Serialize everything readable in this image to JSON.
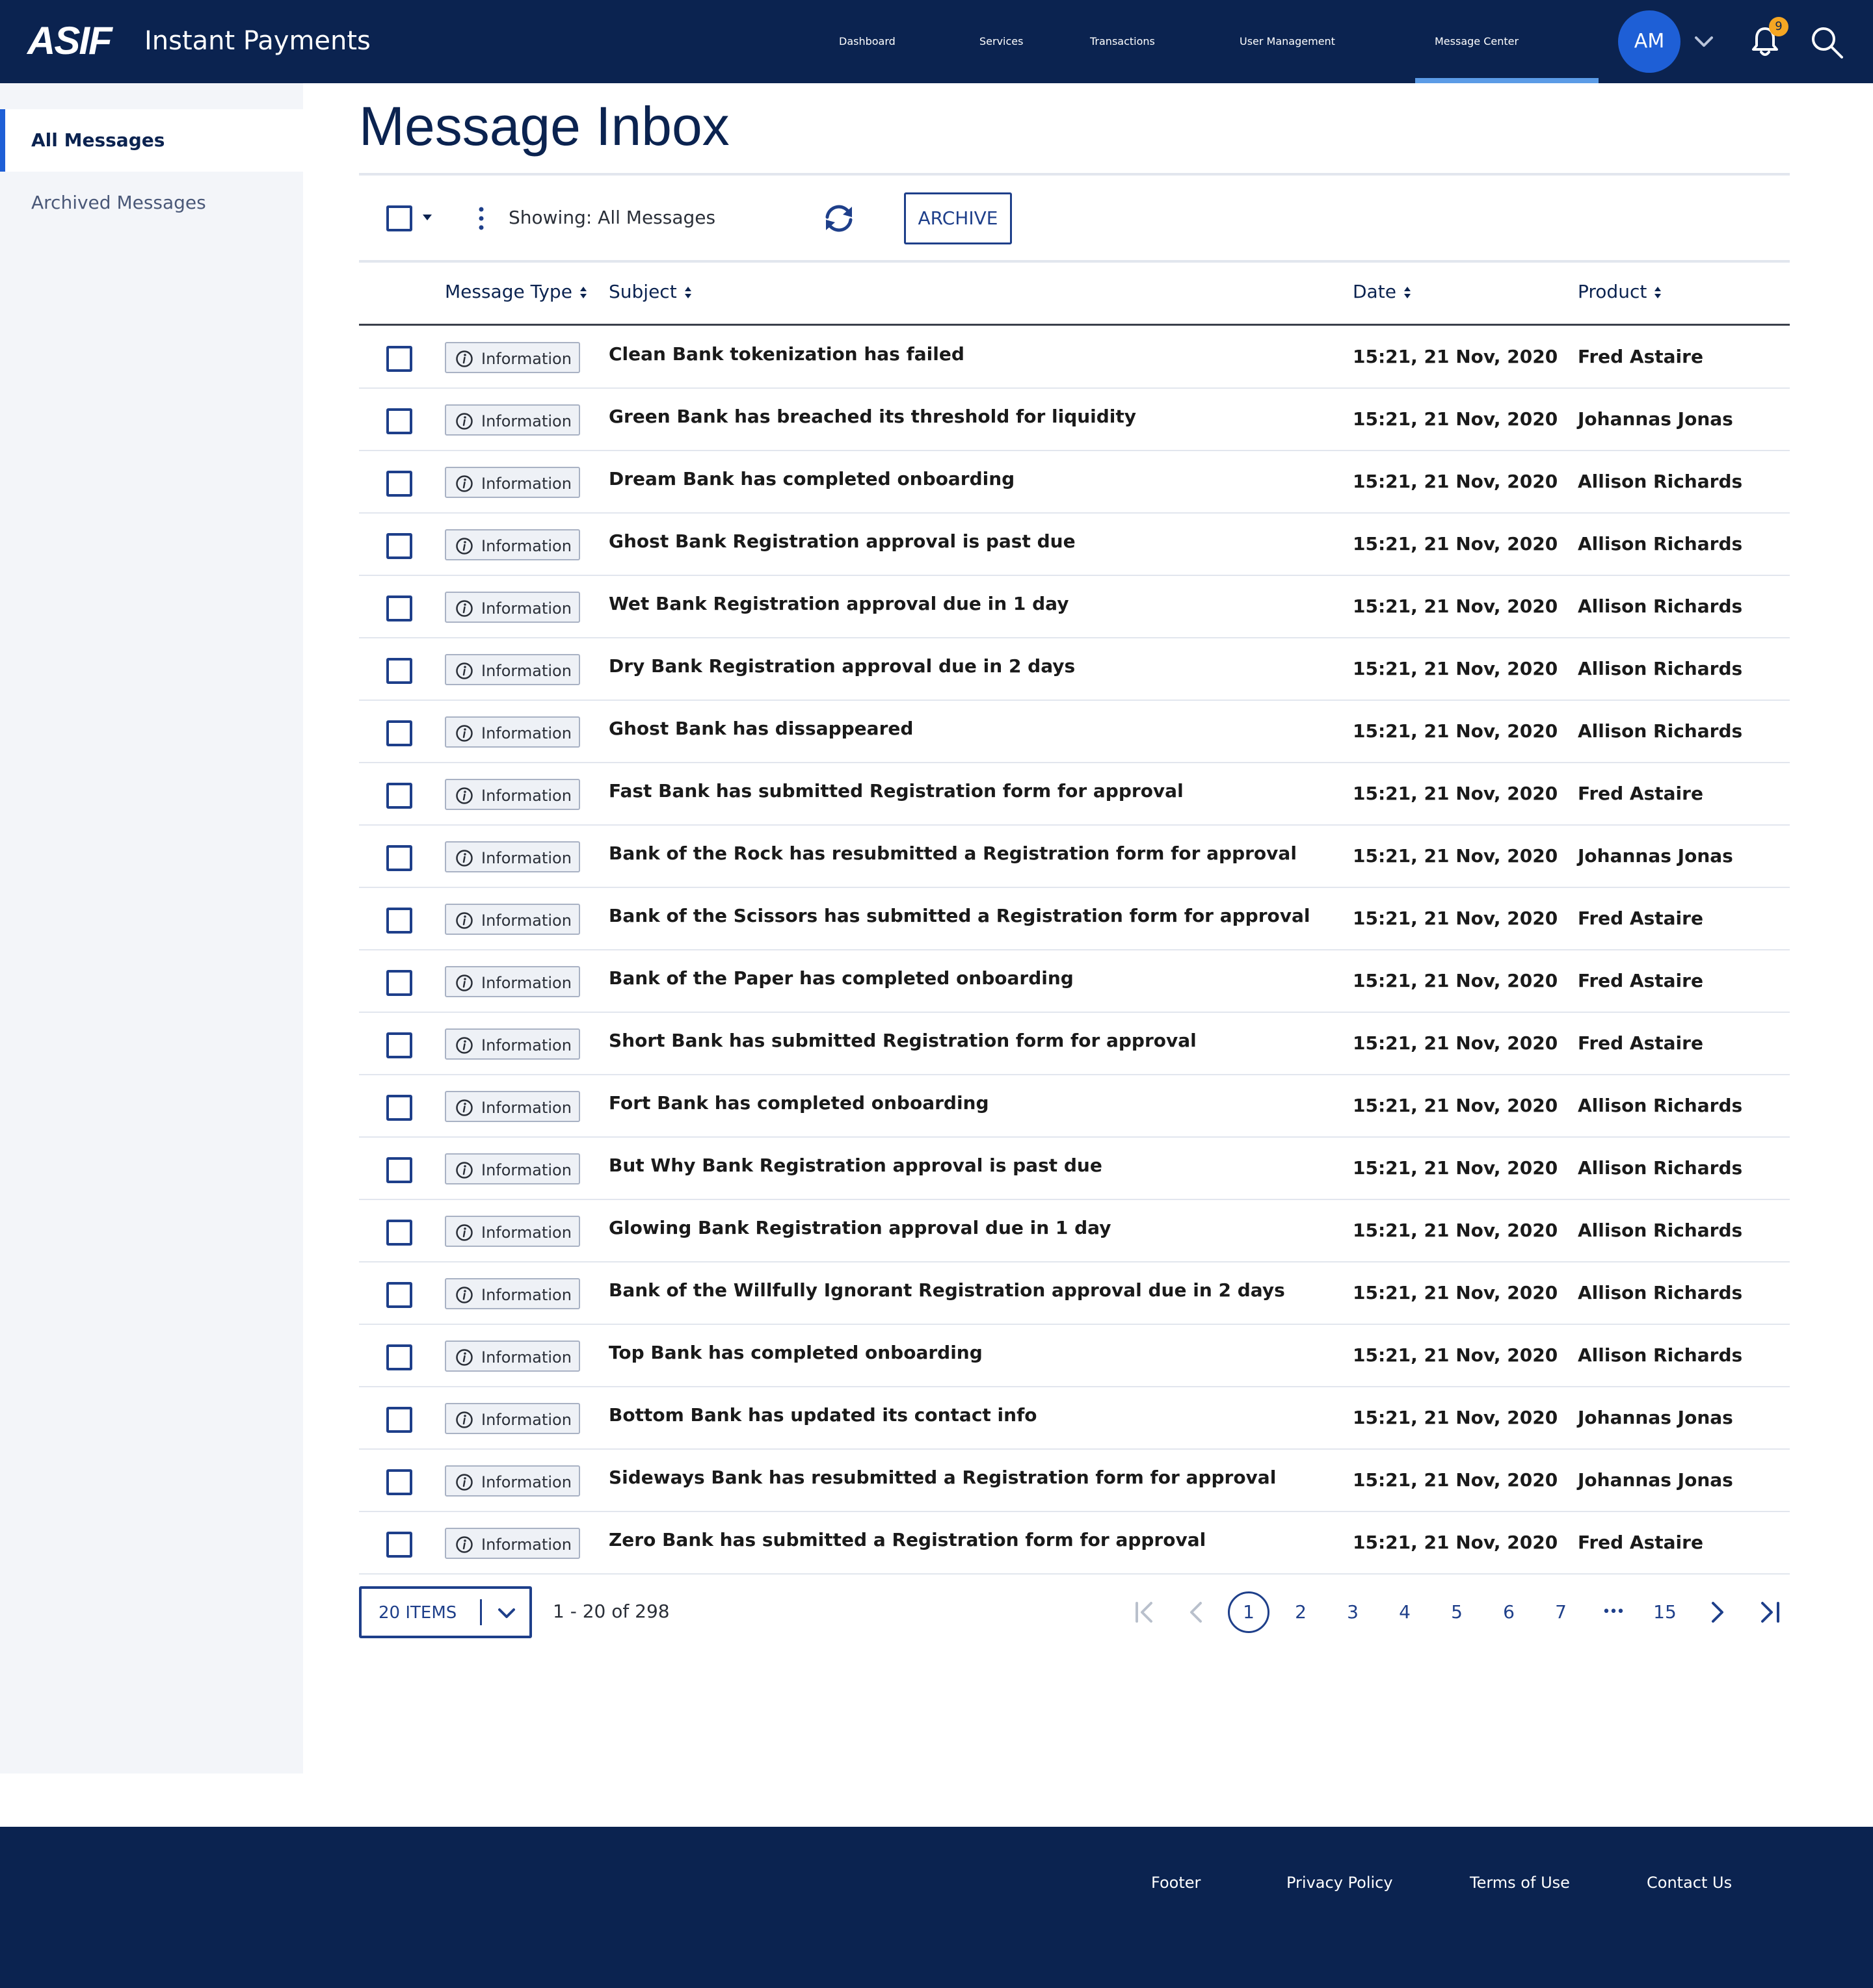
{
  "header": {
    "logo": "ASIF",
    "app_title": "Instant Payments",
    "nav": [
      "Dashboard",
      "Services",
      "Transactions",
      "User Management",
      "Message Center"
    ],
    "active_nav": "Message Center",
    "avatar_initials": "AM",
    "notification_count": "9"
  },
  "sidebar": {
    "items": [
      "All Messages",
      "Archived Messages"
    ],
    "active": "All Messages"
  },
  "main": {
    "title": "Message Inbox",
    "toolbar": {
      "showing": "Showing: All Messages",
      "archive_label": "ARCHIVE"
    },
    "columns": [
      "Message Type",
      "Subject",
      "Date",
      "Product"
    ],
    "rows": [
      {
        "type": "Information",
        "subject": "Clean Bank tokenization has failed",
        "date": "15:21, 21 Nov, 2020",
        "product": "Fred Astaire"
      },
      {
        "type": "Information",
        "subject": "Green Bank has breached its threshold for liquidity",
        "date": "15:21, 21 Nov, 2020",
        "product": "Johannas Jonas"
      },
      {
        "type": "Information",
        "subject": "Dream Bank has completed onboarding",
        "date": "15:21, 21 Nov, 2020",
        "product": "Allison Richards"
      },
      {
        "type": "Information",
        "subject": "Ghost Bank Registration approval is past due",
        "date": "15:21, 21 Nov, 2020",
        "product": "Allison Richards"
      },
      {
        "type": "Information",
        "subject": "Wet Bank Registration approval due in 1 day",
        "date": "15:21, 21 Nov, 2020",
        "product": "Allison Richards"
      },
      {
        "type": "Information",
        "subject": "Dry Bank Registration approval due in 2 days",
        "date": "15:21, 21 Nov, 2020",
        "product": "Allison Richards"
      },
      {
        "type": "Information",
        "subject": "Ghost Bank has dissappeared",
        "date": "15:21, 21 Nov, 2020",
        "product": "Allison Richards"
      },
      {
        "type": "Information",
        "subject": "Fast Bank has submitted Registration form for approval",
        "date": "15:21, 21 Nov, 2020",
        "product": "Fred Astaire"
      },
      {
        "type": "Information",
        "subject": "Bank of the Rock has resubmitted a Registration form for approval",
        "date": "15:21, 21 Nov, 2020",
        "product": "Johannas Jonas"
      },
      {
        "type": "Information",
        "subject": "Bank of the Scissors has submitted a Registration form for approval",
        "date": "15:21, 21 Nov, 2020",
        "product": "Fred Astaire"
      },
      {
        "type": "Information",
        "subject": "Bank of the Paper has completed onboarding",
        "date": "15:21, 21 Nov, 2020",
        "product": "Fred Astaire"
      },
      {
        "type": "Information",
        "subject": "Short Bank has submitted Registration form for approval",
        "date": "15:21, 21 Nov, 2020",
        "product": "Fred Astaire"
      },
      {
        "type": "Information",
        "subject": "Fort Bank has completed onboarding",
        "date": "15:21, 21 Nov, 2020",
        "product": "Allison Richards"
      },
      {
        "type": "Information",
        "subject": "But Why Bank Registration approval is past due",
        "date": "15:21, 21 Nov, 2020",
        "product": "Allison Richards"
      },
      {
        "type": "Information",
        "subject": "Glowing Bank Registration approval due in 1 day",
        "date": "15:21, 21 Nov, 2020",
        "product": "Allison Richards"
      },
      {
        "type": "Information",
        "subject": "Bank of the Willfully Ignorant Registration approval due in 2 days",
        "date": "15:21, 21 Nov, 2020",
        "product": "Allison Richards"
      },
      {
        "type": "Information",
        "subject": "Top Bank has completed onboarding",
        "date": "15:21, 21 Nov, 2020",
        "product": "Allison Richards"
      },
      {
        "type": "Information",
        "subject": "Bottom Bank has updated its contact info",
        "date": "15:21, 21 Nov, 2020",
        "product": "Johannas Jonas"
      },
      {
        "type": "Information",
        "subject": "Sideways Bank has resubmitted a Registration form for approval",
        "date": "15:21, 21 Nov, 2020",
        "product": "Johannas Jonas"
      },
      {
        "type": "Information",
        "subject": "Zero Bank has submitted a Registration form for approval",
        "date": "15:21, 21 Nov, 2020",
        "product": "Fred Astaire"
      }
    ],
    "pagination": {
      "page_size_label": "20 ITEMS",
      "range": "1 - 20 of 298",
      "pages": [
        "1",
        "2",
        "3",
        "4",
        "5",
        "6",
        "7"
      ],
      "ellipsis": "•••",
      "last_page": "15",
      "current_page": "1"
    }
  },
  "footer": {
    "links": [
      "Footer",
      "Privacy Policy",
      "Terms of Use",
      "Contact Us"
    ]
  },
  "colors": {
    "navy": "#0b2350",
    "accent_blue": "#1e5fd6",
    "badge": "#f5a623"
  }
}
